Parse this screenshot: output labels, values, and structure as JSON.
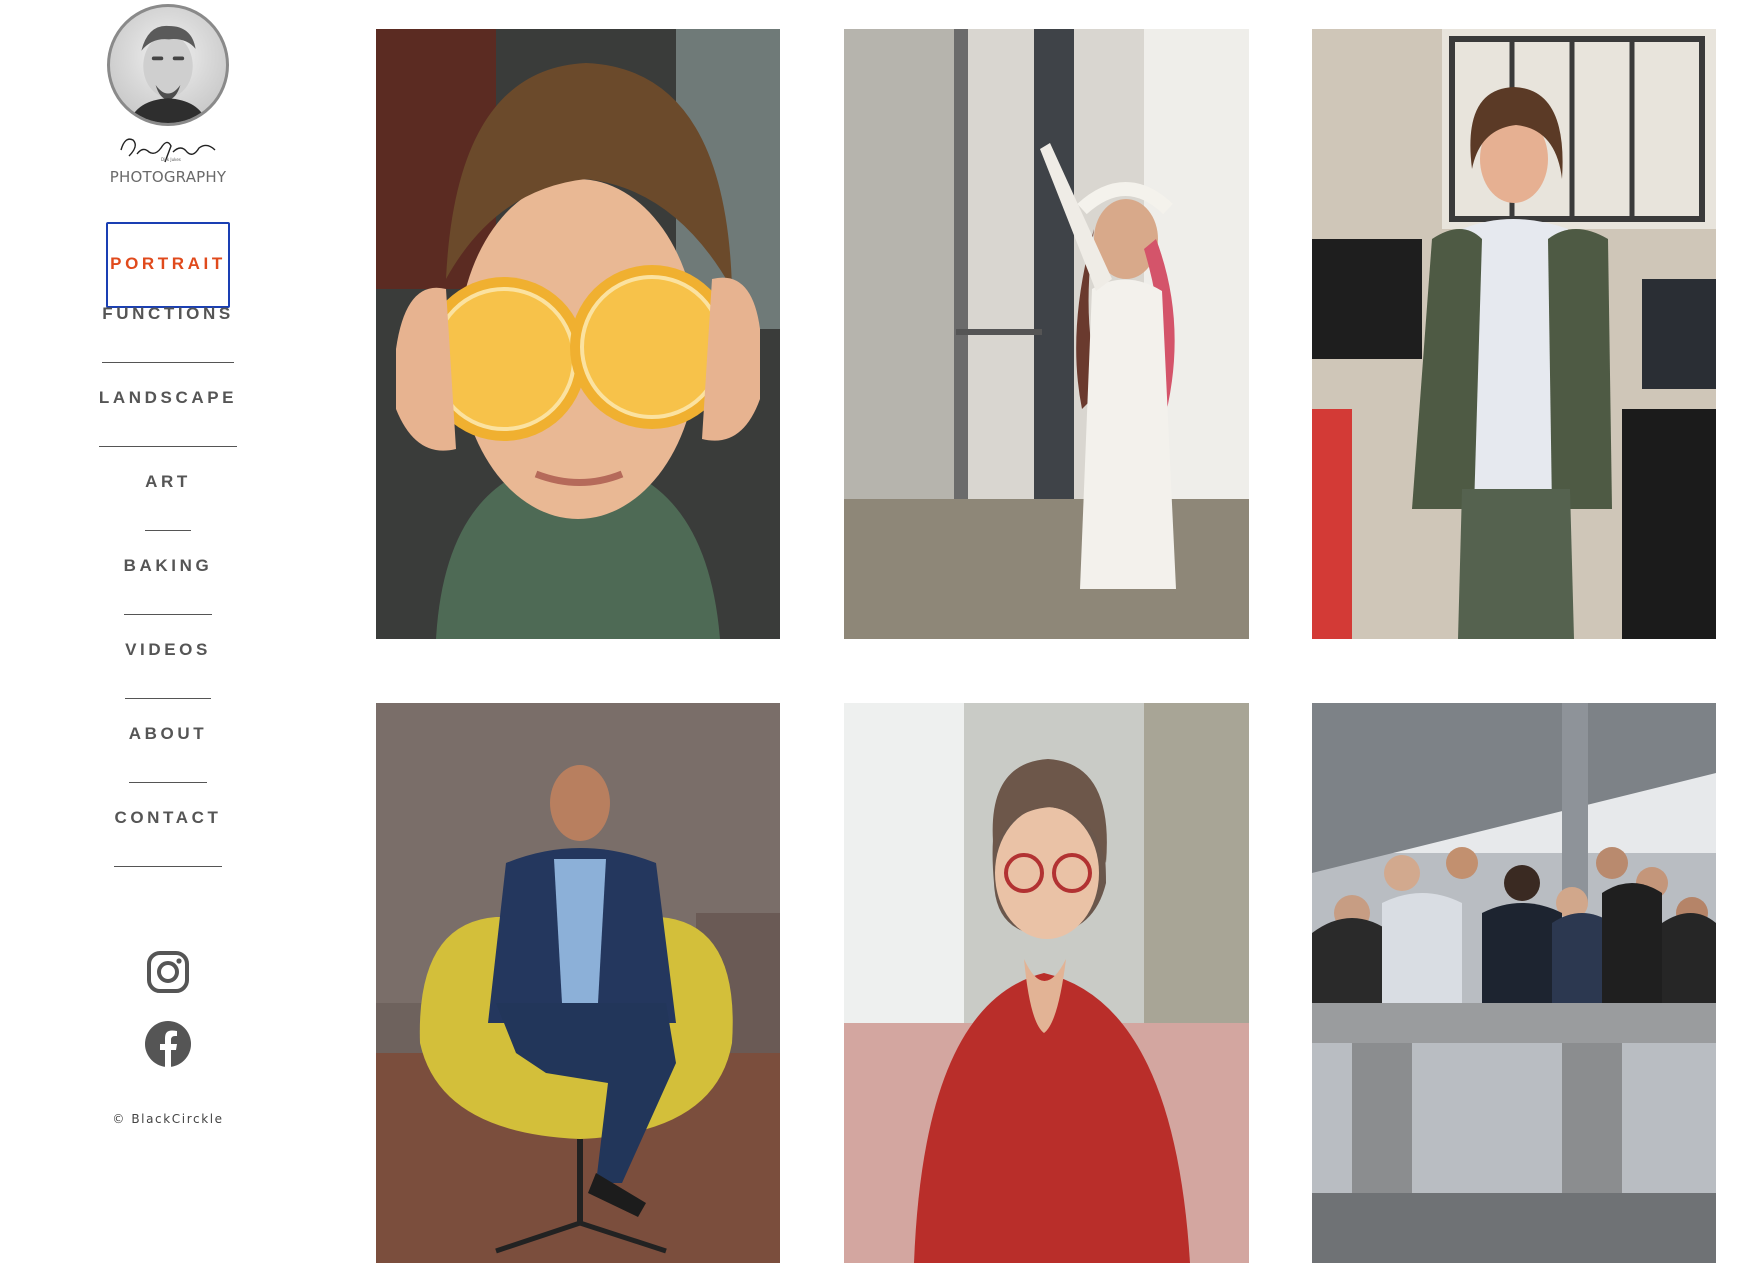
{
  "brand": {
    "signature": "Dirk Jukes",
    "logo_text": "PHOTOGRAPHY"
  },
  "nav": {
    "items": [
      {
        "label": "PORTRAIT",
        "active": true
      },
      {
        "label": "FUNCTIONS",
        "active": false
      },
      {
        "label": "LANDSCAPE",
        "active": false
      },
      {
        "label": "ART",
        "active": false
      },
      {
        "label": "BAKING",
        "active": false
      },
      {
        "label": "VIDEOS",
        "active": false
      },
      {
        "label": "ABOUT",
        "active": false
      },
      {
        "label": "CONTACT",
        "active": false
      }
    ]
  },
  "social": {
    "icons": [
      "instagram-icon",
      "facebook-icon"
    ]
  },
  "footer": {
    "copyright": "© BlackCirckle"
  },
  "colors": {
    "nav_text": "#555555",
    "active_text": "#e04a1c",
    "active_border": "#1a3fb3"
  },
  "gallery": {
    "photos": [
      {
        "subject": "boy holding orange halves over eyes"
      },
      {
        "subject": "woman in white dress with flower crown by window"
      },
      {
        "subject": "woman in green cardigan in office"
      },
      {
        "subject": "man in blue suit seated in yellow chair"
      },
      {
        "subject": "woman with red glasses in red blouse"
      },
      {
        "subject": "group of people at concrete table"
      }
    ]
  }
}
